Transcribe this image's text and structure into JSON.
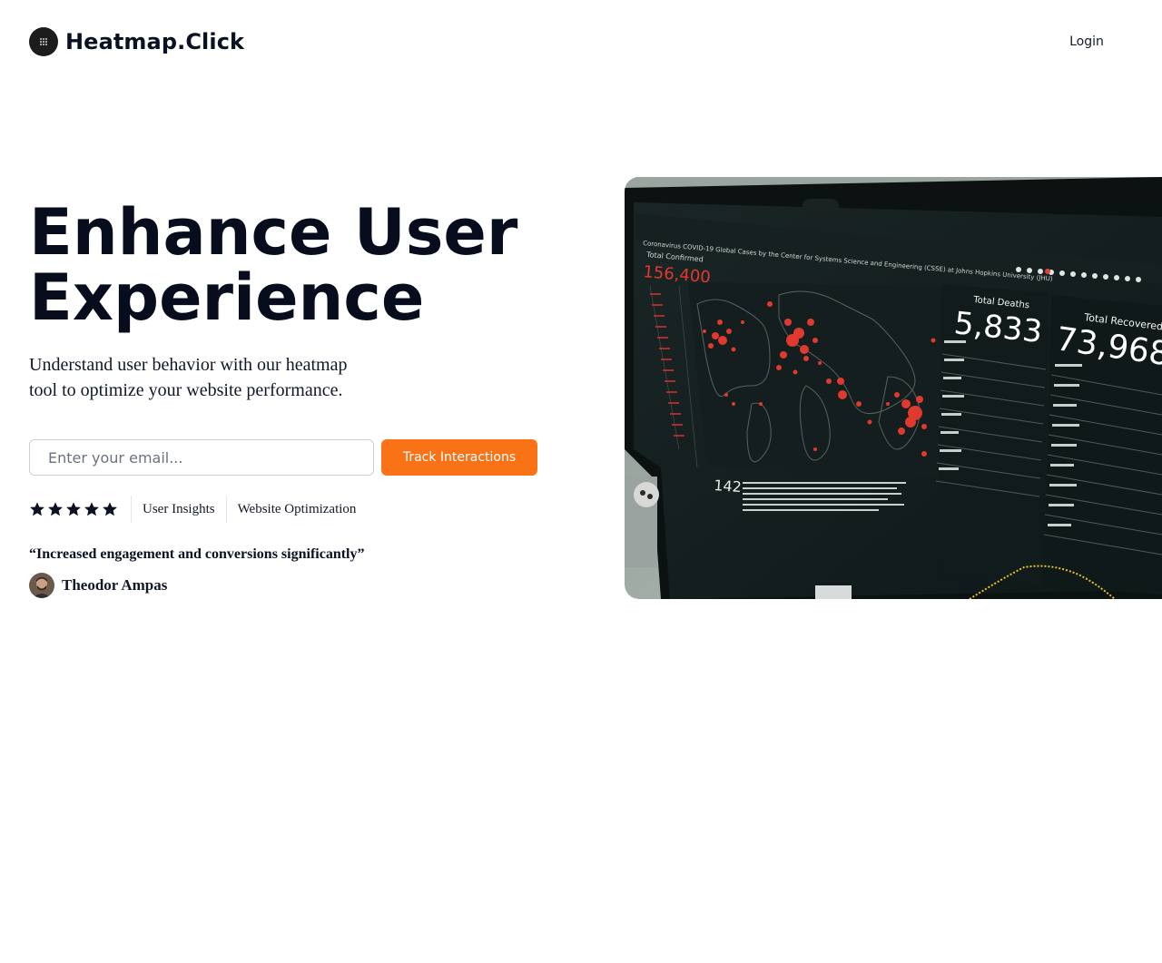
{
  "header": {
    "brand": "Heatmap.Click",
    "login_label": "Login"
  },
  "hero": {
    "title_line1": "Enhance User",
    "title_line2": "Experience",
    "subtitle": "Understand user behavior with our heatmap tool to optimize your website performance.",
    "email_placeholder": "Enter your email...",
    "cta_label": "Track Interactions",
    "rating_stars": 5,
    "tags": [
      "User Insights",
      "Website Optimization"
    ],
    "testimonial_quote": "“Increased engagement and conversions significantly”",
    "testimonial_author": "Theodor Ampas"
  },
  "hero_image": {
    "screen_labels": {
      "confirmed_label": "Total Confirmed",
      "confirmed_value": "156,400",
      "deaths_label": "Total Deaths",
      "deaths_value": "5,833",
      "recovered_label": "Total Recovered",
      "recovered_value": "73,968",
      "count_value": "142"
    }
  },
  "colors": {
    "accent": "#f97316",
    "heading": "#070d1c",
    "logo_bg": "#1c1c1c"
  },
  "icons": [
    "grid-dots-icon",
    "star-icon"
  ]
}
